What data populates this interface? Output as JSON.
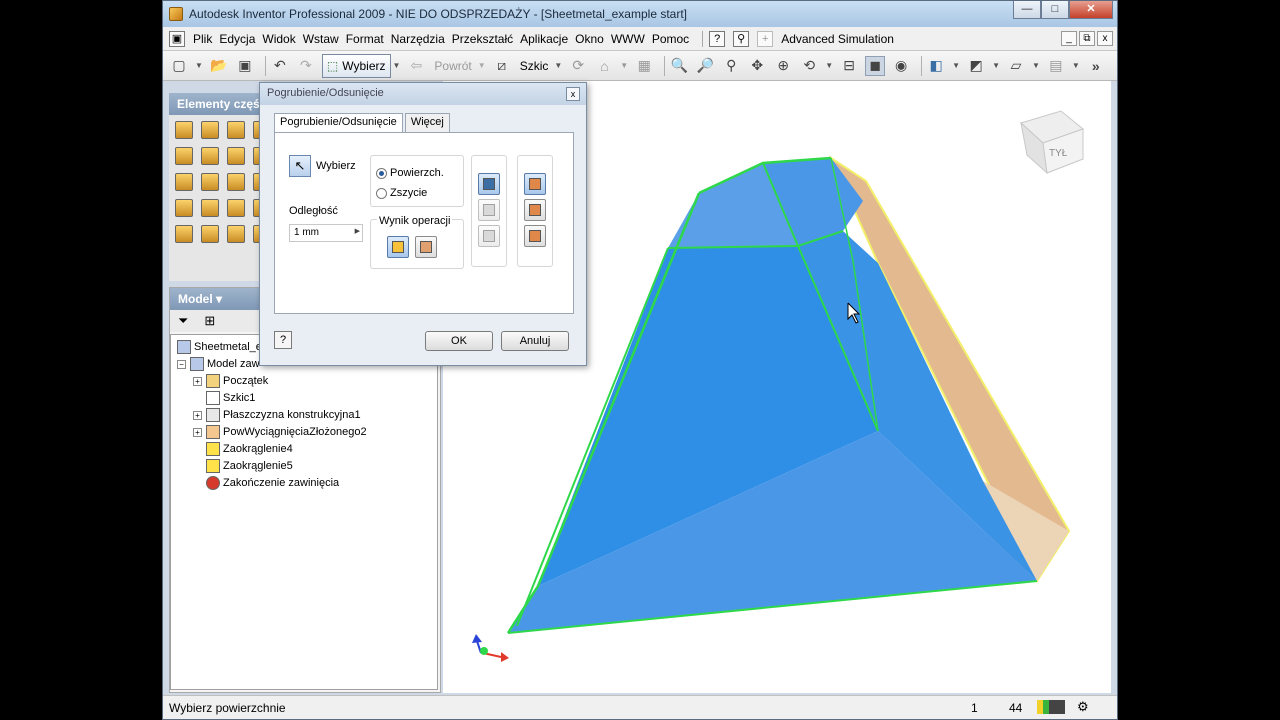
{
  "title": "Autodesk Inventor Professional 2009 - NIE DO ODSPRZEDAŻY - [Sheetmetal_example start]",
  "window_buttons": {
    "minimize": "—",
    "maximize": "□",
    "close": "✕"
  },
  "menu": {
    "items": [
      "Plik",
      "Edycja",
      "Widok",
      "Wstaw",
      "Format",
      "Narzędzia",
      "Przekształć",
      "Aplikacje",
      "Okno",
      "WWW",
      "Pomoc"
    ],
    "advanced": "Advanced Simulation",
    "mdi": {
      "minimize": "_",
      "restore": "⧉",
      "close": "x"
    }
  },
  "toolbar": {
    "select_label": "Wybierz",
    "back_label": "Powrót",
    "sketch_label": "Szkic"
  },
  "palette": {
    "header": "Elementy częś"
  },
  "model": {
    "header": "Model ▾",
    "tree": [
      {
        "label": "Sheetmetal_ex",
        "icon": "part-icon"
      },
      {
        "label": "Model zaw",
        "icon": "model-icon"
      },
      {
        "label": "Początek",
        "icon": "folder-icon"
      },
      {
        "label": "Szkic1",
        "icon": "sketch-icon"
      },
      {
        "label": "Płaszczyzna konstrukcyjna1",
        "icon": "plane-icon"
      },
      {
        "label": "PowWyciągnięciaZłożonego2",
        "icon": "fold-icon"
      },
      {
        "label": "Zaokrąglenie4",
        "icon": "round-icon"
      },
      {
        "label": "Zaokrąglenie5",
        "icon": "round-icon"
      },
      {
        "label": "Zakończenie zawinięcia",
        "icon": "error-icon"
      }
    ]
  },
  "dialog": {
    "title": "Pogrubienie/Odsunięcie",
    "tabs": [
      "Pogrubienie/Odsunięcie",
      "Więcej"
    ],
    "select_label": "Wybierz",
    "distance_label": "Odległość",
    "distance_value": "1 mm",
    "radio": [
      "Powierzch.",
      "Zszycie"
    ],
    "result_label": "Wynik operacji",
    "ok": "OK",
    "cancel": "Anuluj",
    "help": "?"
  },
  "viewcube": {
    "face_label": "TYŁ"
  },
  "status": {
    "message": "Wybierz powierzchnie",
    "value_1": "1",
    "value_2": "44"
  },
  "colors": {
    "face_blue": "#2f8ee6",
    "edge_green": "#2ed84a",
    "face_tan": "#e3b98f",
    "edge_yellow": "#f2ef6a"
  }
}
